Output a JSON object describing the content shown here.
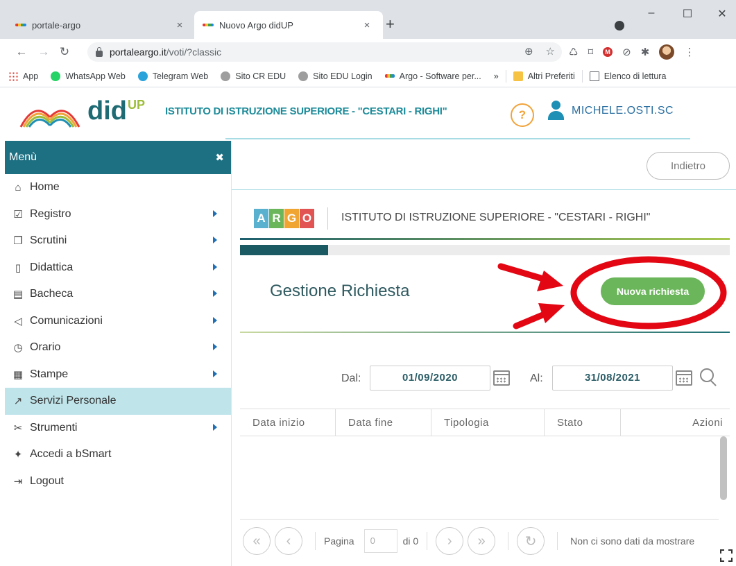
{
  "browser": {
    "tabs": [
      {
        "title": "portale-argo",
        "close": "×"
      },
      {
        "title": "Nuovo Argo didUP",
        "close": "×"
      }
    ],
    "new_tab": "+",
    "window_controls": {
      "minimize": "–",
      "maximize": "☐",
      "close": "✕"
    },
    "url_host": "portaleargo.it",
    "url_path": "/voti/?classic",
    "bookmarks": [
      {
        "label": "App",
        "icon": "apps-grid-icon"
      },
      {
        "label": "WhatsApp Web",
        "icon": "whatsapp-icon"
      },
      {
        "label": "Telegram Web",
        "icon": "telegram-icon"
      },
      {
        "label": "Sito CR EDU",
        "icon": "site-icon"
      },
      {
        "label": "Sito EDU Login",
        "icon": "site-icon"
      },
      {
        "label": "Argo - Software per...",
        "icon": "argo-icon"
      }
    ],
    "bookmarks_overflow": "»",
    "other_bookmarks": "Altri Preferiti",
    "reading_list": "Elenco di lettura"
  },
  "header": {
    "logo_main": "did",
    "logo_sup": "UP",
    "school": "ISTITUTO DI ISTRUZIONE SUPERIORE - \"CESTARI - RIGHI\"",
    "help": "?",
    "username": "MICHELE.OSTI.SC"
  },
  "menu": {
    "title": "Menù",
    "close": "✖",
    "items": [
      {
        "label": "Home",
        "icon": "home-icon",
        "glyph": "⌂",
        "arrow": false,
        "active": false
      },
      {
        "label": "Registro",
        "icon": "calendar-check-icon",
        "glyph": "☑",
        "arrow": true,
        "active": false
      },
      {
        "label": "Scrutini",
        "icon": "document-icon",
        "glyph": "❐",
        "arrow": true,
        "active": false
      },
      {
        "label": "Didattica",
        "icon": "book-icon",
        "glyph": "▯",
        "arrow": true,
        "active": false
      },
      {
        "label": "Bacheca",
        "icon": "notes-icon",
        "glyph": "▤",
        "arrow": true,
        "active": false
      },
      {
        "label": "Comunicazioni",
        "icon": "megaphone-icon",
        "glyph": "◁",
        "arrow": true,
        "active": false
      },
      {
        "label": "Orario",
        "icon": "clock-icon",
        "glyph": "◷",
        "arrow": true,
        "active": false
      },
      {
        "label": "Stampe",
        "icon": "printer-icon",
        "glyph": "▦",
        "arrow": true,
        "active": false
      },
      {
        "label": "Servizi Personale",
        "icon": "share-icon",
        "glyph": "↗",
        "arrow": false,
        "active": true
      },
      {
        "label": "Strumenti",
        "icon": "tools-icon",
        "glyph": "✂",
        "arrow": true,
        "active": false
      },
      {
        "label": "Accedi a bSmart",
        "icon": "bsmart-icon",
        "glyph": "✦",
        "arrow": false,
        "active": false
      },
      {
        "label": "Logout",
        "icon": "logout-icon",
        "glyph": "⇥",
        "arrow": false,
        "active": false
      }
    ]
  },
  "content": {
    "back_label": "Indietro",
    "argo_letters": [
      "A",
      "R",
      "G",
      "O"
    ],
    "argo_colors": [
      "#5ab1cf",
      "#6bb55a",
      "#f0a431",
      "#e25454"
    ],
    "argo_school": "ISTITUTO DI ISTRUZIONE SUPERIORE - \"CESTARI - RIGHI\"",
    "progress": 0.18,
    "page_title": "Gestione Richiesta",
    "new_request_label": "Nuova richiesta",
    "filter": {
      "from_label": "Dal:",
      "from_value": "01/09/2020",
      "to_label": "Al:",
      "to_value": "31/08/2021"
    },
    "table": {
      "columns": [
        "Data inizio",
        "Data fine",
        "Tipologia",
        "Stato",
        "Azioni"
      ]
    },
    "pager": {
      "first": "«",
      "prev": "‹",
      "page_label": "Pagina",
      "page_value": "0",
      "of_label": "di 0",
      "next": "›",
      "last": "»",
      "refresh": "↻",
      "no_data": "Non ci sono dati da mostrare"
    }
  },
  "colors": {
    "menu_header": "#1d6f82",
    "active_item": "#bfe4ea",
    "new_button": "#6bb55a",
    "annotation_red": "#e30613"
  }
}
